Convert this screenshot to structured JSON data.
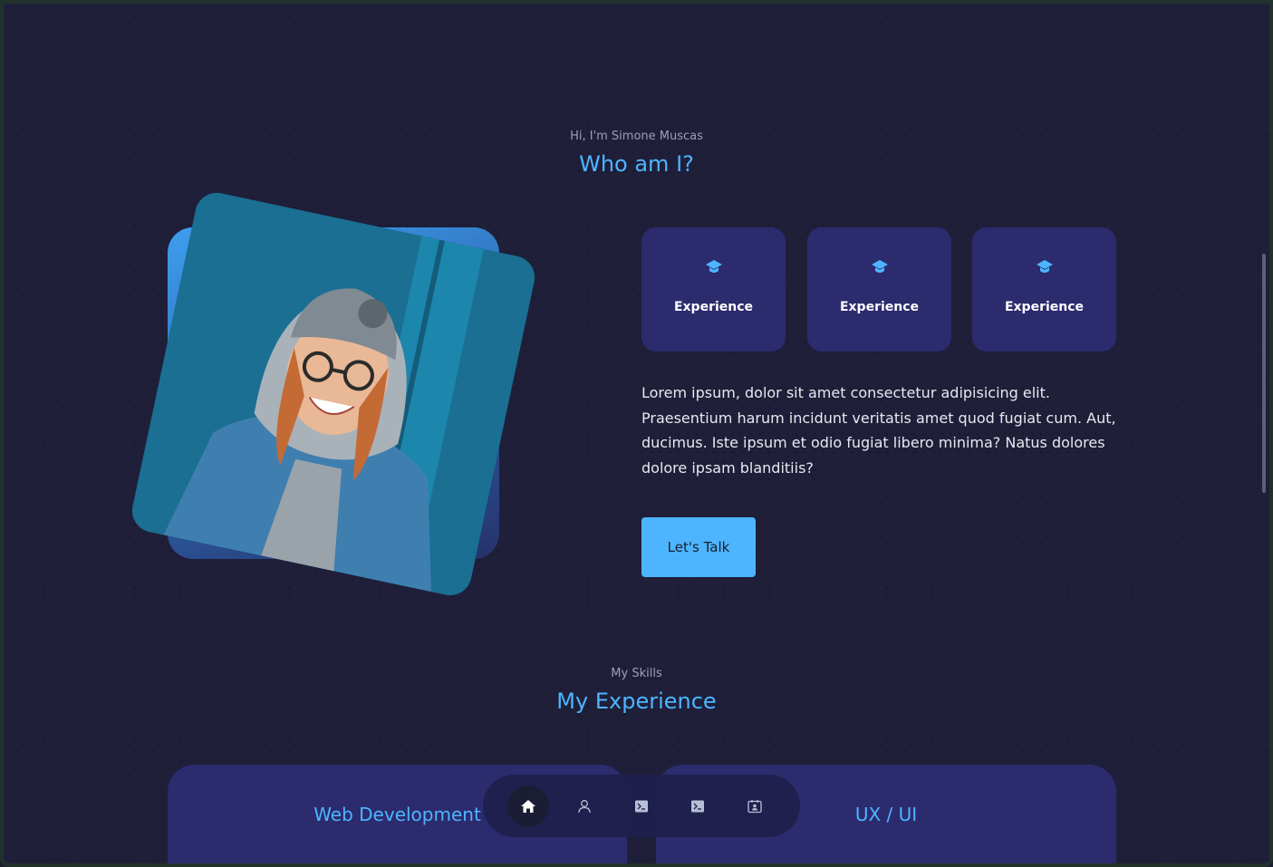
{
  "about": {
    "greeting": "Hi, I'm Simone Muscas",
    "title": "Who am I?",
    "stats": [
      {
        "icon": "graduation-cap-icon",
        "label": "Experience"
      },
      {
        "icon": "graduation-cap-icon",
        "label": "Experience"
      },
      {
        "icon": "graduation-cap-icon",
        "label": "Experience"
      }
    ],
    "description": "Lorem ipsum, dolor sit amet consectetur adipisicing elit. Praesentium harum incidunt veritatis amet quod fugiat cum. Aut, ducimus. Iste ipsum et odio fugiat libero minima? Natus dolores dolore ipsam blanditiis?",
    "cta_label": "Let's Talk"
  },
  "skills": {
    "eyebrow": "My Skills",
    "title": "My Experience",
    "cards": [
      {
        "title": "Web Development"
      },
      {
        "title": "UX / UI"
      }
    ]
  },
  "dock": {
    "items": [
      {
        "icon": "home-icon",
        "active": true
      },
      {
        "icon": "user-icon",
        "active": false
      },
      {
        "icon": "terminal-icon",
        "active": false
      },
      {
        "icon": "terminal-icon",
        "active": false
      },
      {
        "icon": "contact-card-icon",
        "active": false
      }
    ]
  },
  "colors": {
    "accent": "#4db5ff",
    "card": "#2c2b6e",
    "background": "#1f1f3a"
  }
}
